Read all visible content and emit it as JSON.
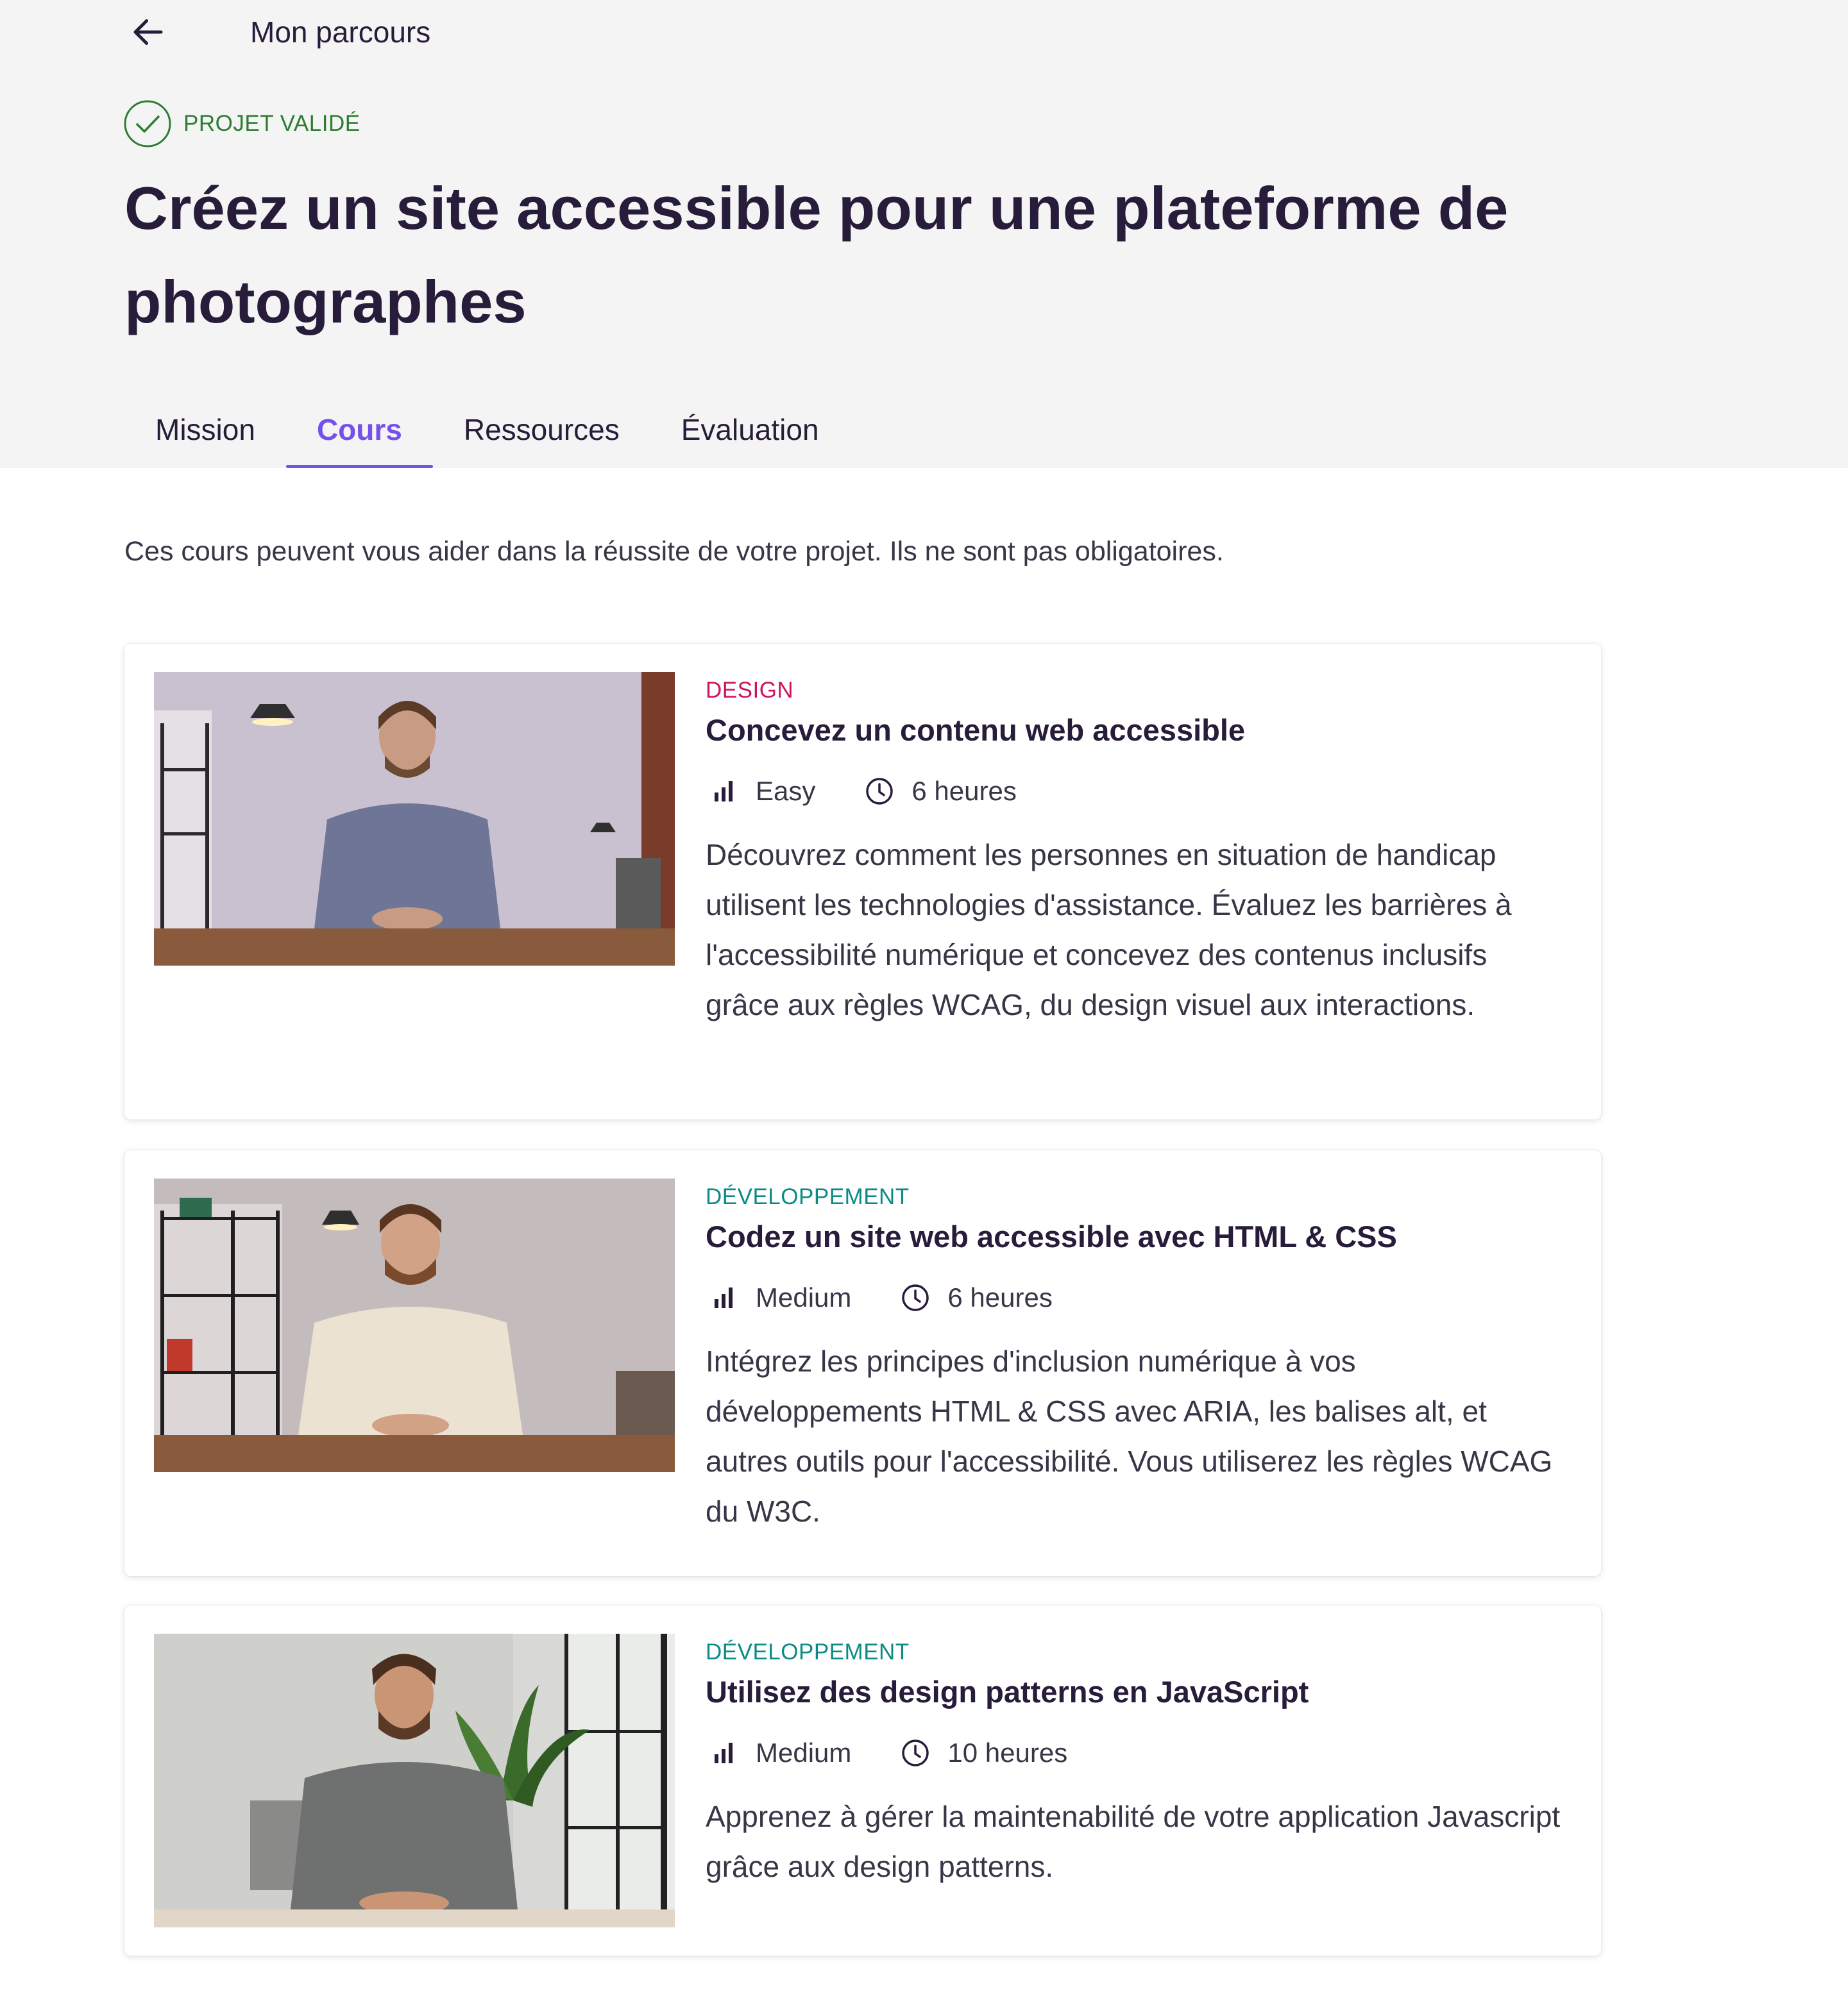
{
  "header": {
    "back_label": "Mon parcours",
    "status_label": "PROJET VALIDÉ",
    "title": "Créez un site accessible pour une plateforme de photographes"
  },
  "tabs": [
    {
      "label": "Mission",
      "active": false
    },
    {
      "label": "Cours",
      "active": true
    },
    {
      "label": "Ressources",
      "active": false
    },
    {
      "label": "Évaluation",
      "active": false
    }
  ],
  "intro": "Ces cours peuvent vous aider dans la réussite de votre projet. Ils ne sont pas obligatoires.",
  "courses": [
    {
      "category": "DESIGN",
      "title": "Concevez un contenu web accessible",
      "level": "Easy",
      "duration": "6 heures",
      "description": "Découvrez comment les personnes en situation de handicap utilisent les technologies d'assistance. Évaluez les barrières à l'accessibilité numérique et concevez des contenus inclusifs grâce aux règles WCAG, du design visuel aux interactions."
    },
    {
      "category": "DÉVELOPPEMENT",
      "title": "Codez un site web accessible avec HTML & CSS",
      "level": "Medium",
      "duration": "6 heures",
      "description": "Intégrez les principes d'inclusion numérique à vos développements HTML & CSS avec ARIA, les balises alt, et autres outils pour l'accessibilité. Vous utiliserez les règles WCAG du W3C."
    },
    {
      "category": "DÉVELOPPEMENT",
      "title": "Utilisez des design patterns en JavaScript",
      "level": "Medium",
      "duration": "10 heures",
      "description": "Apprenez à gérer la maintenabilité de votre application Javascript grâce aux design patterns."
    }
  ],
  "colors": {
    "header_bg": "#f4f4f4",
    "title": "#271c3a",
    "accent": "#7451eb",
    "success": "#2e7d32",
    "design_category": "#d0135d",
    "dev_category": "#0d8a86"
  },
  "icons": {
    "back": "arrow-left-icon",
    "status": "check-circle-icon",
    "level": "difficulty-bars-icon",
    "duration": "clock-icon"
  }
}
